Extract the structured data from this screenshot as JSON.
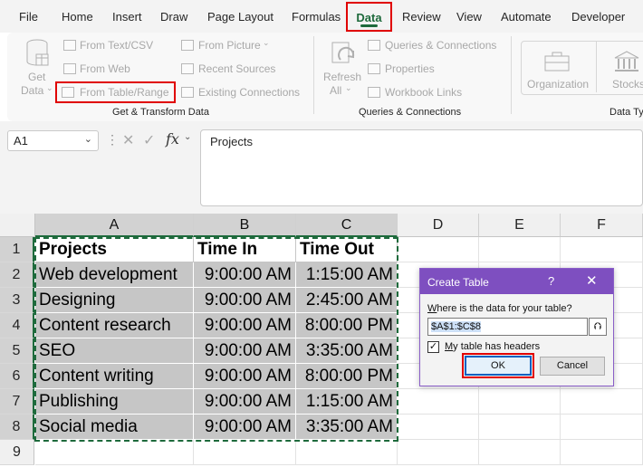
{
  "tabs": [
    "File",
    "Home",
    "Insert",
    "Draw",
    "Page Layout",
    "Formulas",
    "Data",
    "Review",
    "View",
    "Automate",
    "Developer"
  ],
  "active_tab": "Data",
  "ribbon": {
    "get_data_line1": "Get",
    "get_data_line2": "Data",
    "from_text_csv": "From Text/CSV",
    "from_web": "From Web",
    "from_table_range": "From Table/Range",
    "from_picture": "From Picture",
    "recent_sources": "Recent Sources",
    "existing_connections": "Existing Connections",
    "group_get_transform": "Get & Transform Data",
    "refresh_line1": "Refresh",
    "refresh_line2": "All",
    "queries_connections": "Queries & Connections",
    "properties": "Properties",
    "workbook_links": "Workbook Links",
    "group_queries": "Queries & Connections",
    "organization": "Organization",
    "stocks": "Stocks",
    "group_datatypes": "Data Ty"
  },
  "formula_bar": {
    "name_box": "A1",
    "fx": "fx",
    "value": "Projects"
  },
  "grid": {
    "columns": [
      "A",
      "B",
      "C",
      "D",
      "E",
      "F"
    ],
    "rows": [
      "1",
      "2",
      "3",
      "4",
      "5",
      "6",
      "7",
      "8",
      "9"
    ],
    "header": [
      "Projects",
      "Time In",
      "Time Out"
    ],
    "data": [
      [
        "Web development",
        "9:00:00 AM",
        "1:15:00 AM"
      ],
      [
        "Designing",
        "9:00:00 AM",
        "2:45:00 AM"
      ],
      [
        "Content research",
        "9:00:00 AM",
        "8:00:00 PM"
      ],
      [
        "SEO",
        "9:00:00 AM",
        "3:35:00 AM"
      ],
      [
        "Content writing",
        "9:00:00 AM",
        "8:00:00 PM"
      ],
      [
        "Publishing",
        "9:00:00 AM",
        "1:15:00 AM"
      ],
      [
        "Social media",
        "9:00:00 AM",
        "3:35:00 AM"
      ]
    ]
  },
  "dialog": {
    "title": "Create Table",
    "help": "?",
    "close": "✕",
    "question_prefix": "W",
    "question_rest": "here is the data for your table?",
    "range": "$A$1:$C$8",
    "collapse": "⮉",
    "checkbox_checked": "✓",
    "checkbox_label_prefix": "M",
    "checkbox_label_rest": "y table has headers",
    "ok": "OK",
    "cancel": "Cancel"
  },
  "colors": {
    "accent_green": "#1e6a3c",
    "highlight_red": "#e00000",
    "dialog_purple": "#7e4fc0"
  }
}
